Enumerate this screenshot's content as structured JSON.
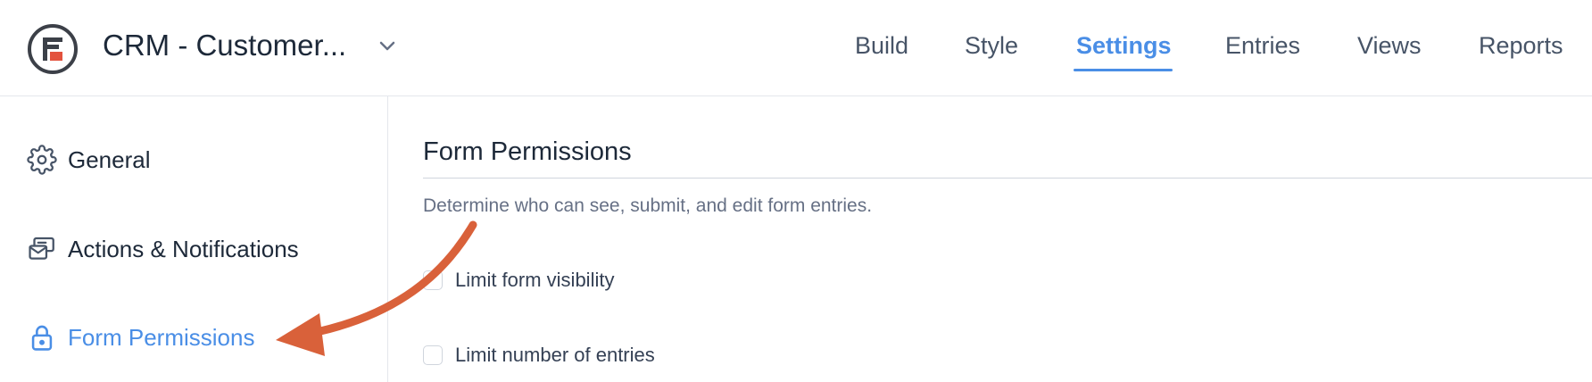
{
  "header": {
    "form_title": "CRM - Customer...",
    "tabs": [
      {
        "label": "Build",
        "active": false
      },
      {
        "label": "Style",
        "active": false
      },
      {
        "label": "Settings",
        "active": true
      },
      {
        "label": "Entries",
        "active": false
      },
      {
        "label": "Views",
        "active": false
      },
      {
        "label": "Reports",
        "active": false
      }
    ]
  },
  "sidebar": {
    "items": [
      {
        "label": "General",
        "icon": "gear-icon",
        "active": false
      },
      {
        "label": "Actions & Notifications",
        "icon": "actions-notifications-icon",
        "active": false
      },
      {
        "label": "Form Permissions",
        "icon": "lock-icon",
        "active": true
      }
    ]
  },
  "main": {
    "section_title": "Form Permissions",
    "description": "Determine who can see, submit, and edit form entries.",
    "options": [
      {
        "label": "Limit form visibility",
        "checked": false
      },
      {
        "label": "Limit number of entries",
        "checked": false
      }
    ]
  },
  "colors": {
    "accent": "#4a8ee6",
    "logo_red": "#e3523d",
    "logo_dark": "#3c4048",
    "annotation_arrow": "#d9613a",
    "text_primary": "#1d2939",
    "text_muted": "#667085"
  }
}
